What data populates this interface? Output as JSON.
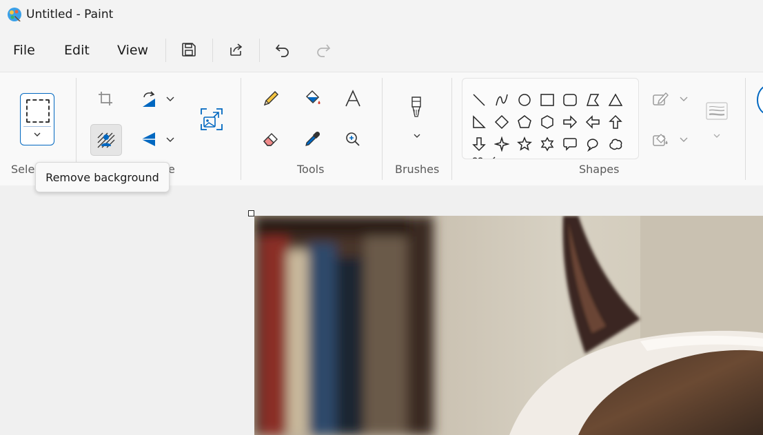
{
  "window": {
    "title": "Untitled - Paint"
  },
  "menu": {
    "file": "File",
    "edit": "Edit",
    "view": "View"
  },
  "groups": {
    "selection": "Sele",
    "image": "e",
    "tools": "Tools",
    "brushes": "Brushes",
    "shapes": "Shapes"
  },
  "tooltip": {
    "text": "Remove background"
  },
  "colors": {
    "accent": "#0067c0",
    "ribbon_bg": "#f9f9f9",
    "window_bg": "#f3f3f3"
  }
}
